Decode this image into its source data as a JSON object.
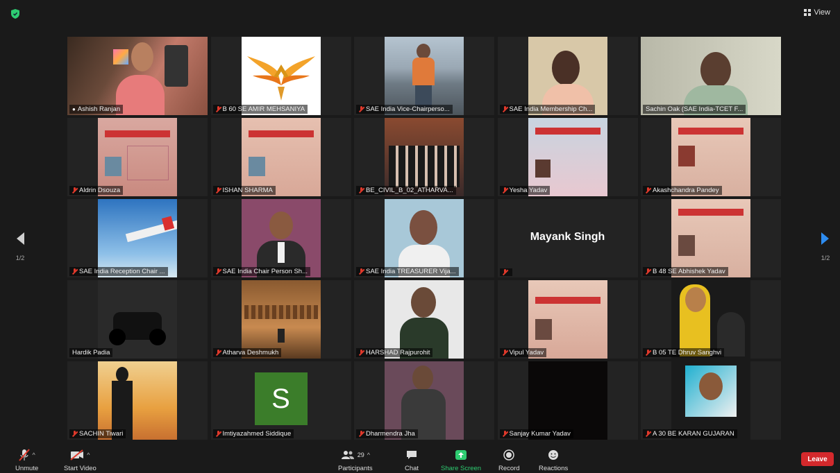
{
  "top": {
    "view_label": "View"
  },
  "nav": {
    "page_left": "1/2",
    "page_right": "1/2"
  },
  "tiles": [
    {
      "name": "Ashish Ranjan",
      "muted": false,
      "active": true
    },
    {
      "name": "B 60 SE AMIR MEHSANIYA",
      "muted": true
    },
    {
      "name": "SAE India Vice-Chairperso...",
      "muted": true
    },
    {
      "name": "SAE India Membership Ch...",
      "muted": true
    },
    {
      "name": "Sachin Oak (SAE India-TCET F...",
      "muted": false
    },
    {
      "name": "Aldrin Dsouza",
      "muted": true
    },
    {
      "name": "ISHAN SHARMA",
      "muted": true
    },
    {
      "name": "BE_CIVIL_B_02_ATHARVA...",
      "muted": true
    },
    {
      "name": "Yesha Yadav",
      "muted": true
    },
    {
      "name": "Akashchandra Pandey",
      "muted": true
    },
    {
      "name": "SAE India Reception Chair ...",
      "muted": true
    },
    {
      "name": "SAE India Chair Person Sh...",
      "muted": true
    },
    {
      "name": "SAE India TREASURER Vija...",
      "muted": true
    },
    {
      "name": "",
      "muted": true,
      "big_name": "Mayank Singh"
    },
    {
      "name": "B 48 SE Abhishek Yadav",
      "muted": true
    },
    {
      "name": "Hardik Padia",
      "muted": false
    },
    {
      "name": "Atharva Deshmukh",
      "muted": true
    },
    {
      "name": "HARSHAD Rajpurohit",
      "muted": true
    },
    {
      "name": "Vipul Yadav",
      "muted": true
    },
    {
      "name": "B 05 TE Dhruv Sanghvi",
      "muted": true
    },
    {
      "name": "SACHIN Tiwari",
      "muted": true
    },
    {
      "name": "Imtiyazahmed Siddique",
      "muted": true,
      "avatar_letter": "S"
    },
    {
      "name": "Dharmendra Jha",
      "muted": true
    },
    {
      "name": "Sanjay Kumar Yadav",
      "muted": true
    },
    {
      "name": "A 30 BE KARAN GUJARAN",
      "muted": true
    }
  ],
  "toolbar": {
    "unmute": "Unmute",
    "start_video": "Start Video",
    "participants": "Participants",
    "participants_count": "29",
    "chat": "Chat",
    "share_screen": "Share Screen",
    "record": "Record",
    "reactions": "Reactions",
    "leave": "Leave"
  }
}
